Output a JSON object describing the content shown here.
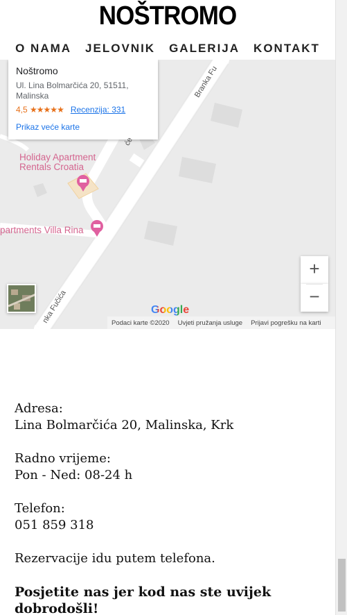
{
  "site": {
    "logo": "NOŠTROMO"
  },
  "nav": [
    {
      "label": "O NAMA"
    },
    {
      "label": "JELOVNIK"
    },
    {
      "label": "GALERIJA"
    },
    {
      "label": "KONTAKT"
    }
  ],
  "map": {
    "card": {
      "title": "Noštromo",
      "address_line1": "Ul. Lina Bolmarčića 20, 51511,",
      "address_line2": "Malinska",
      "rating": "4,5",
      "stars": "★★★★★",
      "reviews": "Recenzija: 331",
      "link": "Prikaz veće karte"
    },
    "pois": {
      "holiday_line1": "Holiday Apartment",
      "holiday_line2": "Rentals Croatia",
      "villa": "partments Villa Rina"
    },
    "roads": {
      "branka_top": "Branka Fu",
      "branka_bottom": "nka Fučića",
      "small": "će"
    },
    "zoom_in": "+",
    "zoom_out": "−",
    "google": "Google",
    "attribution": {
      "data": "Podaci karte ©2020",
      "terms": "Uvjeti pružanja usluge",
      "report": "Prijavi pogrešku na karti"
    },
    "colors": {
      "poi": "#d4658f",
      "link": "#1a73e8",
      "rating": "#e7711b"
    }
  },
  "contact": {
    "address_label": "Adresa:",
    "address_value": "Lina Bolmarčića 20, Malinska, Krk",
    "hours_label": "Radno vrijeme:",
    "hours_value": "Pon - Ned: 08-24 h",
    "phone_label": "Telefon:",
    "phone_value": "051 859 318",
    "reservations": "Rezervacije idu putem telefona.",
    "closing": "Posjetite nas jer kod nas ste uvijek dobrodošli!"
  }
}
